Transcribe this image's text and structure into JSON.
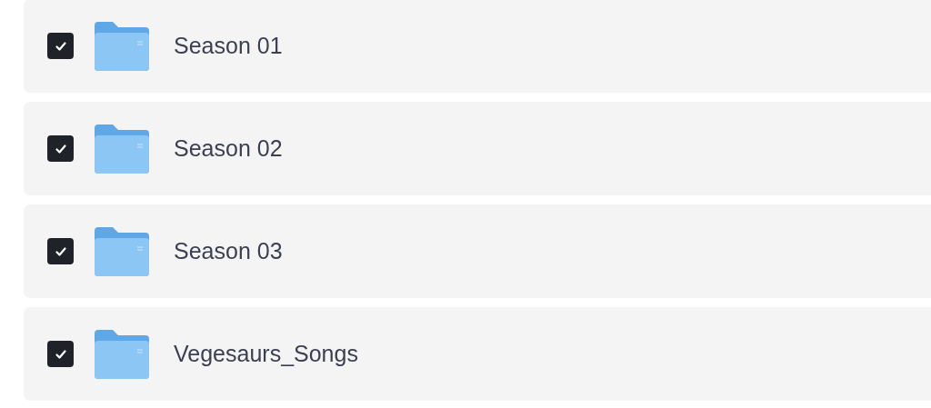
{
  "folders": [
    {
      "name": "Season 01",
      "checked": true
    },
    {
      "name": "Season 02",
      "checked": true
    },
    {
      "name": "Season 03",
      "checked": true
    },
    {
      "name": "Vegesaurs_Songs",
      "checked": true
    }
  ]
}
